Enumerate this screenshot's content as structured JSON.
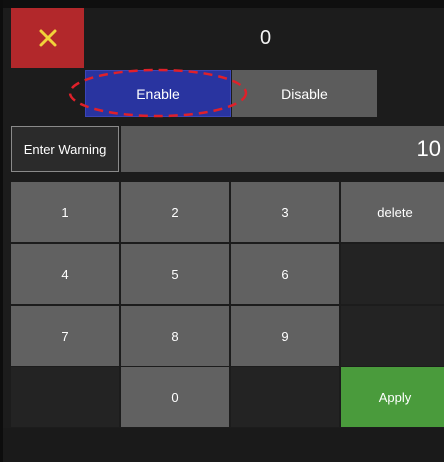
{
  "header": {
    "count_value": "0",
    "close_icon": "x-icon"
  },
  "toggle": {
    "enable_label": "Enable",
    "disable_label": "Disable"
  },
  "warning": {
    "label": "Enter Warning",
    "value": "10"
  },
  "keypad": {
    "key_1": "1",
    "key_2": "2",
    "key_3": "3",
    "delete": "delete",
    "key_4": "4",
    "key_5": "5",
    "key_6": "6",
    "key_7": "7",
    "key_8": "8",
    "key_9": "9",
    "key_0": "0",
    "apply": "Apply"
  },
  "colors": {
    "close_bg": "#b2282b",
    "enable_bg": "#2934a0",
    "apply_bg": "#4a9b3c",
    "highlight": "#e0202a"
  }
}
